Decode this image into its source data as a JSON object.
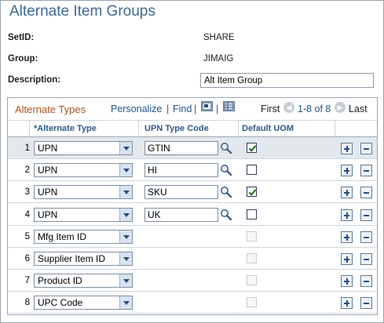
{
  "page": {
    "title": "Alternate Item Groups"
  },
  "fields": {
    "setid": {
      "label": "SetID:",
      "value": "SHARE"
    },
    "group": {
      "label": "Group:",
      "value": "JIMAIG"
    },
    "description": {
      "label": "Description:",
      "value": "Alt Item Group"
    }
  },
  "grid": {
    "title": "Alternate Types",
    "personalize": "Personalize",
    "separator": "|",
    "find": "Find",
    "first": "First",
    "range": "1-8 of 8",
    "last": "Last",
    "columns": {
      "alt_type": "*Alternate Type",
      "upn_type_code": "UPN Type Code",
      "default_uom": "Default UOM"
    },
    "rows": [
      {
        "num": "1",
        "type": "UPN",
        "code": "GTIN",
        "checked": true,
        "enabled": true
      },
      {
        "num": "2",
        "type": "UPN",
        "code": "HI",
        "checked": false,
        "enabled": true
      },
      {
        "num": "3",
        "type": "UPN",
        "code": "SKU",
        "checked": true,
        "enabled": true
      },
      {
        "num": "4",
        "type": "UPN",
        "code": "UK",
        "checked": false,
        "enabled": true
      },
      {
        "num": "5",
        "type": "Mfg Item ID",
        "code": "",
        "checked": false,
        "enabled": false
      },
      {
        "num": "6",
        "type": "Supplier Item ID",
        "code": "",
        "checked": false,
        "enabled": false
      },
      {
        "num": "7",
        "type": "Product ID",
        "code": "",
        "checked": false,
        "enabled": false
      },
      {
        "num": "8",
        "type": "UPC Code",
        "code": "",
        "checked": false,
        "enabled": false
      }
    ]
  },
  "icons": {
    "lookup": "magnifier-icon",
    "checkbox": "check-icon",
    "add": "plus-icon",
    "delete": "minus-icon",
    "prev": "prev-arrow-icon",
    "next": "next-arrow-icon"
  }
}
